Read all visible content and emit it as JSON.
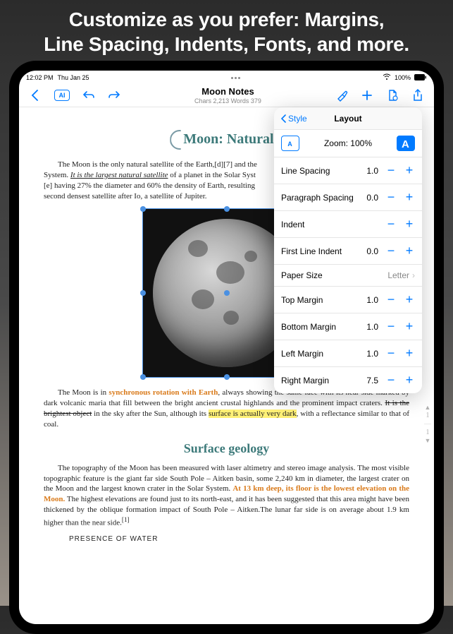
{
  "marketing": {
    "line1": "Customize as you prefer: Margins,",
    "line2": "Line Spacing, Indents, Fonts, and more."
  },
  "status_bar": {
    "time": "12:02 PM",
    "date": "Thu Jan 25",
    "wifi_icon": "wifi",
    "battery": "100%"
  },
  "toolbar": {
    "title": "Moon Notes",
    "stats": "Chars 2,213 Words 379"
  },
  "document": {
    "heading": "Moon: Natural Sa",
    "para1_a": "The Moon is the only natural satellite of the Earth,[d][7] and the",
    "para1_b": "System. ",
    "para1_underline": "It is the largest natural satellite",
    "para1_c": " of a planet in the Solar Syst",
    "para1_d": "[e] having 27% the diameter and 60% the density of Earth, resulting",
    "para1_e": "second densest satellite after Io, a satellite of Jupiter.",
    "para2_a": "The Moon is in ",
    "para2_sync": "synchronous rotation with Earth",
    "para2_b": ", always showing the same face with its near side marked by dark volcanic maria that fill between the bright ancient crustal highlands and the prominent impact craters. ",
    "para2_strike": "It is the brightest object",
    "para2_c": " in the sky after the Sun, although its ",
    "para2_highlight": "surface is actually very dark",
    "para2_d": ", with a reflectance similar to that of coal.",
    "subhead": "Surface geology",
    "para3_a": "The topography of the Moon has been measured with laser altimetry and stereo image analysis. The most visible topographic feature is the giant far side South Pole – Aitken basin, some 2,240 km in diameter, the largest crater on the Moon and the largest known crater in the Solar System. ",
    "para3_orange": "At 13 km deep, its floor is the lowest elevation on the Moon.",
    "para3_b": " The highest elevations are found just to its north-east, and it has been suggested that this area might have been thickened by the oblique formation impact of South Pole – Aitken.The lunar far side is on average about 1.9 km higher than the near side.",
    "para3_ref": "[1]",
    "water_caps": "PRESENCE OF WATER"
  },
  "popover": {
    "back_label": "Style",
    "title": "Layout",
    "zoom_label": "Zoom: 100%",
    "rows": {
      "line_spacing": {
        "label": "Line Spacing",
        "value": "1.0"
      },
      "paragraph_spacing": {
        "label": "Paragraph Spacing",
        "value": "0.0"
      },
      "indent": {
        "label": "Indent",
        "value": ""
      },
      "first_line_indent": {
        "label": "First Line Indent",
        "value": "0.0"
      },
      "paper_size": {
        "label": "Paper Size",
        "value": "Letter"
      },
      "top_margin": {
        "label": "Top Margin",
        "value": "1.0"
      },
      "bottom_margin": {
        "label": "Bottom Margin",
        "value": "1.0"
      },
      "left_margin": {
        "label": "Left Margin",
        "value": "1.0"
      },
      "right_margin": {
        "label": "Right Margin",
        "value": "7.5"
      }
    }
  },
  "page_indicator": {
    "current": "1",
    "total": "1"
  }
}
